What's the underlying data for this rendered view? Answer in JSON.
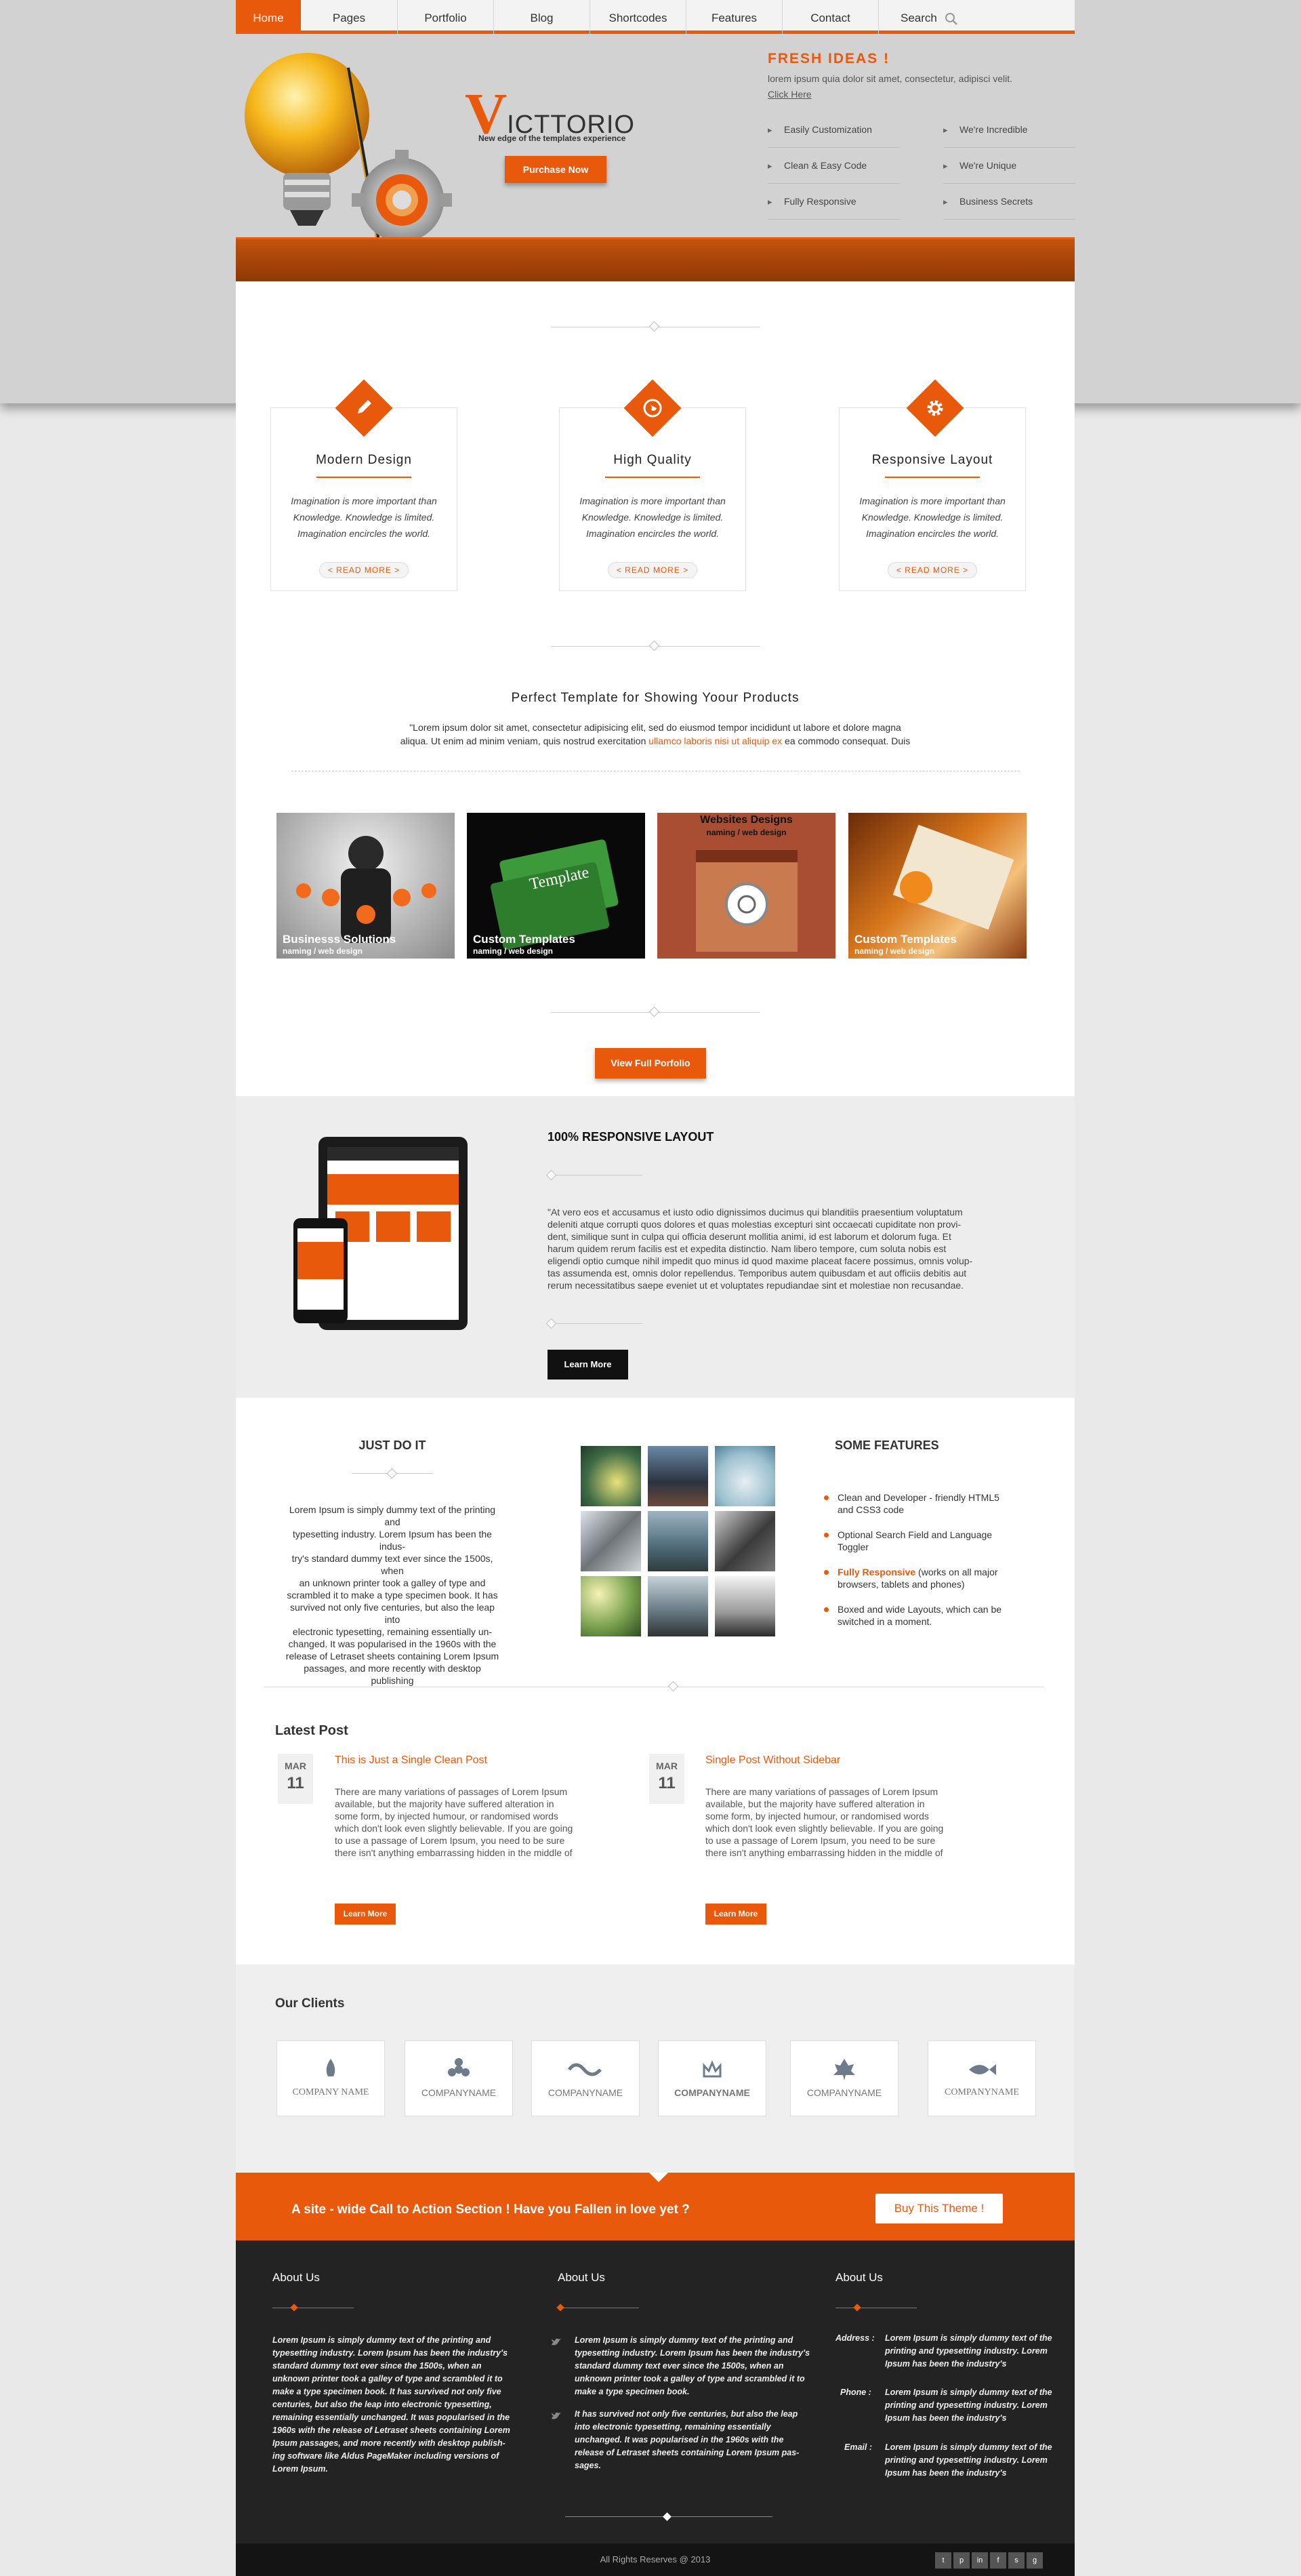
{
  "nav": {
    "items": [
      "Home",
      "Pages",
      "Portfolio",
      "Blog",
      "Shortcodes",
      "Features",
      "Contact"
    ],
    "search": "Search"
  },
  "colors": {
    "accent": "#e8590c",
    "dark": "#232323"
  },
  "hero": {
    "logo_letter": "V",
    "logo_rest": "ICTTORIO",
    "tagline": "New edge of the templates experience",
    "button": "Purchase Now",
    "fresh_title": "FRESH IDEAS !",
    "fresh_text": "lorem ipsum quia dolor sit amet, consectetur, adipisci velit.",
    "click_here": "Click Here",
    "features_left": [
      "Easily Customization",
      "Clean & Easy Code",
      "Fully Responsive"
    ],
    "features_right": [
      "We're Incredible",
      "We're Unique",
      "Business Secrets"
    ]
  },
  "services": [
    {
      "icon": "pencil-icon",
      "title": "Modern Design",
      "lines": [
        "Imagination is more important than",
        "Knowledge. Knowledge is limited.",
        "Imagination encircles the world."
      ],
      "more": "< READ MORE >"
    },
    {
      "icon": "globe-icon",
      "title": "High Quality",
      "lines": [
        "Imagination is more important than",
        "Knowledge. Knowledge is limited.",
        "Imagination encircles the world."
      ],
      "more": "< READ MORE >"
    },
    {
      "icon": "gear-icon",
      "title": "Responsive Layout",
      "lines": [
        "Imagination is more important than",
        "Knowledge. Knowledge is limited.",
        "Imagination encircles the world."
      ],
      "more": "< READ MORE >"
    }
  ],
  "products": {
    "title": "Perfect Template for Showing Yoour Products",
    "line1": "\"Lorem ipsum dolor sit amet, consectetur adipisicing elit, sed do eiusmod tempor incididunt ut labore et dolore magna",
    "line2a": "aliqua. Ut enim ad minim veniam, quis nostrud exercitation",
    "line2b": "ullamco laboris nisi ut aliquip ex",
    "line2c": "ea commodo consequat. Duis"
  },
  "portfolio": [
    {
      "title": "Businesss Solutions",
      "sub": "naming / web design"
    },
    {
      "title": "Custom Templates",
      "sub": "naming / web design"
    },
    {
      "title": "Websites Designs",
      "sub": "naming / web design"
    },
    {
      "title": "Custom Templates",
      "sub": "naming / web design"
    }
  ],
  "portfolio_button": "View Full Porfolio",
  "responsive": {
    "title": "100% RESPONSIVE LAYOUT",
    "text": [
      "\"At vero eos et accusamus et iusto odio dignissimos ducimus qui blanditiis praesentium voluptatum",
      "deleniti atque corrupti quos dolores et quas molestias excepturi sint occaecati cupiditate non provi-",
      "dent, similique sunt in culpa qui officia deserunt mollitia animi, id est laborum et dolorum fuga. Et",
      "harum quidem rerum facilis est et expedita distinctio. Nam libero tempore, cum soluta nobis est",
      "eligendi optio cumque nihil impedit quo minus id quod maxime placeat facere possimus, omnis volup-",
      "tas assumenda est, omnis dolor repellendus. Temporibus autem quibusdam et aut officiis debitis aut",
      "rerum necessitatibus saepe eveniet ut et voluptates repudiandae sint et molestiae non recusandae."
    ],
    "button": "Learn More"
  },
  "justdoit": {
    "title": "JUST DO IT",
    "text": [
      "Lorem Ipsum is simply dummy text of the printing and",
      "typesetting industry. Lorem Ipsum has been the indus-",
      "try's standard dummy text ever since the 1500s, when",
      "an unknown printer took a galley of type and",
      "scrambled it to make a type specimen book. It has",
      "survived not only five centuries, but also the leap into",
      "electronic typesetting, remaining essentially un-",
      "changed. It was popularised in the 1960s with the",
      "release of Letraset sheets containing Lorem Ipsum",
      "passages, and more recently with desktop publishing"
    ]
  },
  "features": {
    "title": "SOME FEATURES",
    "items": [
      {
        "hl": "",
        "text": [
          "Clean and Developer - friendly HTML5",
          "and CSS3 code"
        ]
      },
      {
        "hl": "",
        "text": [
          "Optional Search Field and Language",
          "Toggler"
        ]
      },
      {
        "hl": "Fully Responsive",
        "text": [
          " (works on all major",
          "browsers, tablets and phones)"
        ]
      },
      {
        "hl": "",
        "text": [
          "Boxed and wide Layouts, which can be",
          "switched in a moment."
        ]
      }
    ]
  },
  "posts": {
    "title": "Latest Post",
    "items": [
      {
        "month": "MAR",
        "day": "11",
        "title": "This is Just a Single Clean Post",
        "text": [
          "There are many variations of passages of Lorem Ipsum",
          "available, but the majority have suffered alteration in",
          "some form, by injected humour, or randomised words",
          "which don't look even slightly believable. If you are going",
          "to use a passage of Lorem Ipsum, you need to be sure",
          "there isn't anything embarrassing hidden in the middle of"
        ],
        "button": "Learn More"
      },
      {
        "month": "MAR",
        "day": "11",
        "title": "Single Post Without Sidebar",
        "text": [
          "There are many variations of passages of Lorem Ipsum",
          "available, but the majority have suffered alteration in",
          "some form, by injected humour, or randomised words",
          "which don't look even slightly believable. If you are going",
          "to use a passage of Lorem Ipsum, you need to be sure",
          "there isn't anything embarrassing hidden in the middle of"
        ],
        "button": "Learn More"
      }
    ]
  },
  "clients": {
    "title": "Our Clients",
    "names": [
      "COMPANY NAME",
      "COMPANYNAME",
      "COMPANYNAME",
      "COMPANYNAME",
      "COMPANYNAME",
      "COMPANYNAME"
    ]
  },
  "cta": {
    "text": "A site - wide Call to Action Section ! Have you Fallen in love yet ?",
    "button": "Buy This Theme !"
  },
  "footer": {
    "col1": {
      "title": "About Us",
      "text": [
        "Lorem Ipsum is simply dummy text of the printing and",
        "typesetting industry. Lorem Ipsum has been the industry's",
        "standard dummy text ever since the 1500s, when an",
        "unknown printer took a galley of type and scrambled it to",
        "make a type specimen book. It has survived not only five",
        "centuries, but also the leap into electronic typesetting,",
        "remaining essentially unchanged. It was popularised in the",
        "1960s with the release of Letraset sheets containing Lorem",
        "Ipsum passages, and more recently with desktop publish-",
        "ing software like Aldus PageMaker including versions of",
        "Lorem Ipsum."
      ]
    },
    "col2": {
      "title": "About Us",
      "tweets": [
        [
          "Lorem Ipsum is simply dummy text of the printing and",
          "typesetting industry. Lorem Ipsum has been the industry's",
          "standard dummy text ever since the 1500s, when an",
          "unknown printer took a galley of type and scrambled it to",
          "make a type specimen book."
        ],
        [
          "It has survived not only five centuries, but also the leap",
          "into electronic typesetting, remaining essentially",
          "unchanged. It was popularised in the 1960s with the",
          "release of Letraset sheets containing Lorem Ipsum pas-",
          "sages."
        ]
      ]
    },
    "col3": {
      "title": "About Us",
      "rows": [
        {
          "label": "Address :",
          "text": [
            "Lorem Ipsum is simply dummy text of the",
            "printing and typesetting industry. Lorem",
            "Ipsum has been the industry's"
          ]
        },
        {
          "label": "Phone :",
          "text": [
            "Lorem Ipsum is simply dummy text of the",
            "printing and typesetting industry. Lorem",
            "Ipsum has been the industry's"
          ]
        },
        {
          "label": "Email :",
          "text": [
            "Lorem Ipsum is simply dummy text of the",
            "printing and typesetting industry. Lorem",
            "Ipsum has been the industry's"
          ]
        }
      ]
    },
    "copyright": "All Rights Reserves @ 2013",
    "social": [
      "t",
      "p",
      "in",
      "f",
      "s",
      "g"
    ]
  }
}
